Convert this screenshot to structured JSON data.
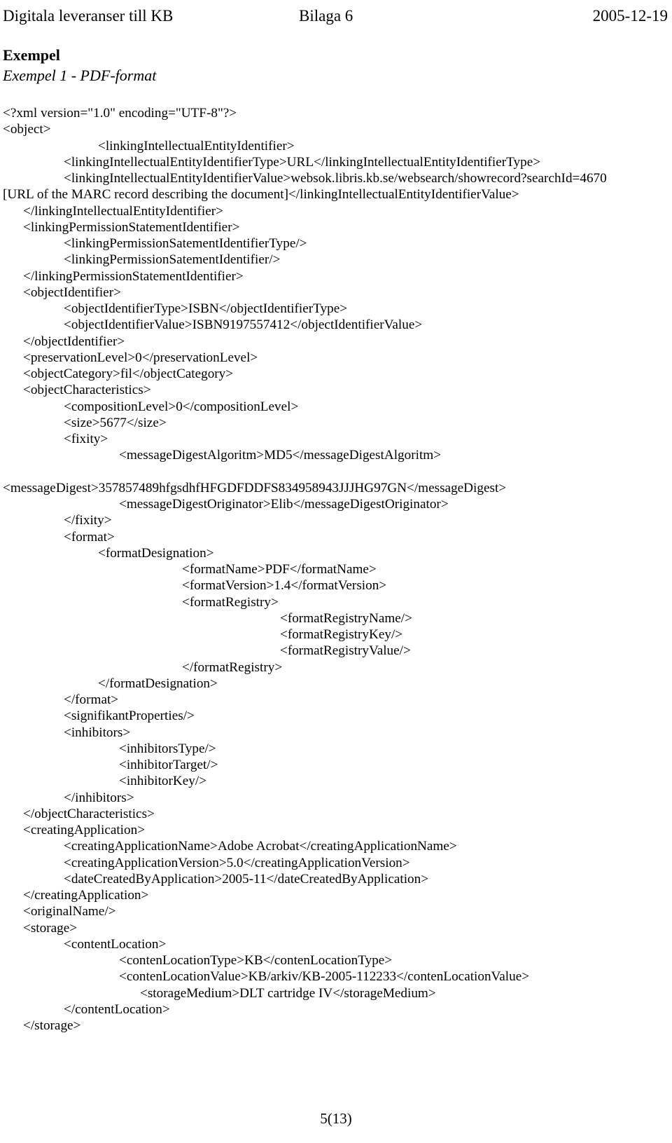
{
  "header": {
    "left": "Digitala leveranser till KB",
    "center": "Bilaga 6",
    "right": "2005-12-19"
  },
  "headings": {
    "title": "Exempel",
    "subtitle": "Exempel 1 - PDF-format"
  },
  "code_listing": {
    "lines": [
      {
        "indent": 0,
        "text": "<?xml version=\"1.0\" encoding=\"UTF-8\"?>"
      },
      {
        "indent": 0,
        "text": "<object>"
      },
      {
        "indent": 4,
        "text": "<linkingIntellectualEntityIdentifier>"
      },
      {
        "indent": 3,
        "text": "<linkingIntellectualEntityIdentifierType>URL</linkingIntellectualEntityIdentifierType>"
      },
      {
        "indent": 3,
        "text": "<linkingIntellectualEntityIdentifierValue>websok.libris.kb.se/websearch/showrecord?searchId=4670"
      },
      {
        "indent": 0,
        "text": "[URL of the MARC record describing the document]</linkingIntellectualEntityIdentifierValue>"
      },
      {
        "indent": 1,
        "text": "</linkingIntellectualEntityIdentifier>"
      },
      {
        "indent": 1,
        "text": "<linkingPermissionStatementIdentifier>"
      },
      {
        "indent": 3,
        "text": "<linkingPermissionSatementIdentifierType/>"
      },
      {
        "indent": 3,
        "text": "<linkingPermissionSatementIdentifier/>"
      },
      {
        "indent": 1,
        "text": "</linkingPermissionStatementIdentifier>"
      },
      {
        "indent": 1,
        "text": "<objectIdentifier>"
      },
      {
        "indent": 3,
        "text": "<objectIdentifierType>ISBN</objectIdentifierType>"
      },
      {
        "indent": 3,
        "text": "<objectIdentifierValue>ISBN9197557412</objectIdentifierValue>"
      },
      {
        "indent": 1,
        "text": "</objectIdentifier>"
      },
      {
        "indent": 1,
        "text": "<preservationLevel>0</preservationLevel>"
      },
      {
        "indent": 1,
        "text": "<objectCategory>fil</objectCategory>"
      },
      {
        "indent": 1,
        "text": "<objectCharacteristics>"
      },
      {
        "indent": 3,
        "text": "<compositionLevel>0</compositionLevel>"
      },
      {
        "indent": 3,
        "text": "<size>5677</size>"
      },
      {
        "indent": 3,
        "text": "<fixity>"
      },
      {
        "indent": 5,
        "text": "<messageDigestAlgoritm>MD5</messageDigestAlgoritm>"
      },
      {
        "indent": -1,
        "text": ""
      },
      {
        "indent": 0,
        "text": "<messageDigest>357857489hfgsdhfHFGDFDDFS834958943JJJHG97GN</messageDigest>"
      },
      {
        "indent": 5,
        "text": "<messageDigestOriginator>Elib</messageDigestOriginator>"
      },
      {
        "indent": 3,
        "text": "</fixity>"
      },
      {
        "indent": 3,
        "text": "<format>"
      },
      {
        "indent": 4,
        "text": "<formatDesignation>"
      },
      {
        "indent": 7,
        "text": "<formatName>PDF</formatName>"
      },
      {
        "indent": 7,
        "text": "<formatVersion>1.4</formatVersion>"
      },
      {
        "indent": 7,
        "text": "<formatRegistry>"
      },
      {
        "indent": 9,
        "text": "<formatRegistryName/>"
      },
      {
        "indent": 9,
        "text": "<formatRegistryKey/>"
      },
      {
        "indent": 9,
        "text": "<formatRegistryValue/>"
      },
      {
        "indent": 7,
        "text": "</formatRegistry>"
      },
      {
        "indent": 4,
        "text": "</formatDesignation>"
      },
      {
        "indent": 3,
        "text": "</format>"
      },
      {
        "indent": 3,
        "text": "<signifikantProperties/>"
      },
      {
        "indent": 3,
        "text": "<inhibitors>"
      },
      {
        "indent": 5,
        "text": "<inhibitorsType/>"
      },
      {
        "indent": 5,
        "text": "<inhibitorTarget/>"
      },
      {
        "indent": 5,
        "text": "<inhibitorKey/>"
      },
      {
        "indent": 3,
        "text": "</inhibitors>"
      },
      {
        "indent": 1,
        "text": "</objectCharacteristics>"
      },
      {
        "indent": 1,
        "text": "<creatingApplication>"
      },
      {
        "indent": 3,
        "text": "<creatingApplicationName>Adobe Acrobat</creatingApplicationName>"
      },
      {
        "indent": 3,
        "text": "<creatingApplicationVersion>5.0</creatingApplicationVersion>"
      },
      {
        "indent": 3,
        "text": "<dateCreatedByApplication>2005-11</dateCreatedByApplication>"
      },
      {
        "indent": 1,
        "text": "</creatingApplication>"
      },
      {
        "indent": 1,
        "text": "<originalName/>"
      },
      {
        "indent": 1,
        "text": "<storage>"
      },
      {
        "indent": 3,
        "text": "<contentLocation>"
      },
      {
        "indent": 5,
        "text": "<contenLocationType>KB</contenLocationType>"
      },
      {
        "indent": 5,
        "text": "<contenLocationValue>KB/arkiv/KB-2005-112233</contenLocationValue>"
      },
      {
        "indent": 6,
        "text": "<storageMedium>DLT cartridge IV</storageMedium>"
      },
      {
        "indent": 3,
        "text": "</contentLocation>"
      },
      {
        "indent": 1,
        "text": "</storage>"
      }
    ]
  },
  "footer": {
    "page_number": "5(13)"
  }
}
